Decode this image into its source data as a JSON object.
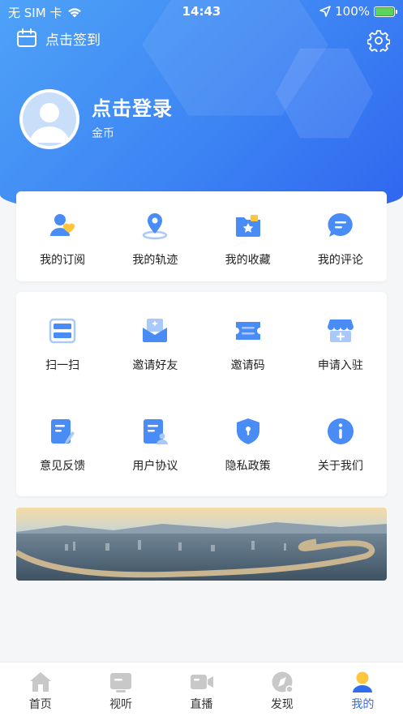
{
  "status_bar": {
    "carrier": "无 SIM 卡",
    "time": "14:43",
    "battery": "100%"
  },
  "header": {
    "checkin_label": "点击签到",
    "login_title": "点击登录",
    "coins_label": "金币"
  },
  "quick_menu": [
    {
      "label": "我的订阅",
      "icon": "subscription-icon"
    },
    {
      "label": "我的轨迹",
      "icon": "location-pin-icon"
    },
    {
      "label": "我的收藏",
      "icon": "favorites-folder-icon"
    },
    {
      "label": "我的评论",
      "icon": "comment-icon"
    }
  ],
  "tools_menu": [
    {
      "label": "扫一扫",
      "icon": "scan-icon"
    },
    {
      "label": "邀请好友",
      "icon": "invite-friend-icon"
    },
    {
      "label": "邀请码",
      "icon": "invite-code-icon"
    },
    {
      "label": "申请入驻",
      "icon": "store-apply-icon"
    },
    {
      "label": "意见反馈",
      "icon": "feedback-icon"
    },
    {
      "label": "用户协议",
      "icon": "user-agreement-icon"
    },
    {
      "label": "隐私政策",
      "icon": "privacy-shield-icon"
    },
    {
      "label": "关于我们",
      "icon": "info-icon"
    }
  ],
  "tabbar": [
    {
      "label": "首页",
      "icon": "home-icon",
      "active": false
    },
    {
      "label": "视听",
      "icon": "video-player-icon",
      "active": false
    },
    {
      "label": "直播",
      "icon": "live-camera-icon",
      "active": false
    },
    {
      "label": "发现",
      "icon": "compass-icon",
      "active": false
    },
    {
      "label": "我的",
      "icon": "profile-icon",
      "active": true
    }
  ],
  "colors": {
    "brand": "#2f6df0",
    "icon_blue": "#4a8cf6",
    "icon_light": "#a9c9fb",
    "accent_yellow": "#ffc53d",
    "tab_inactive": "#c8c8c8"
  }
}
